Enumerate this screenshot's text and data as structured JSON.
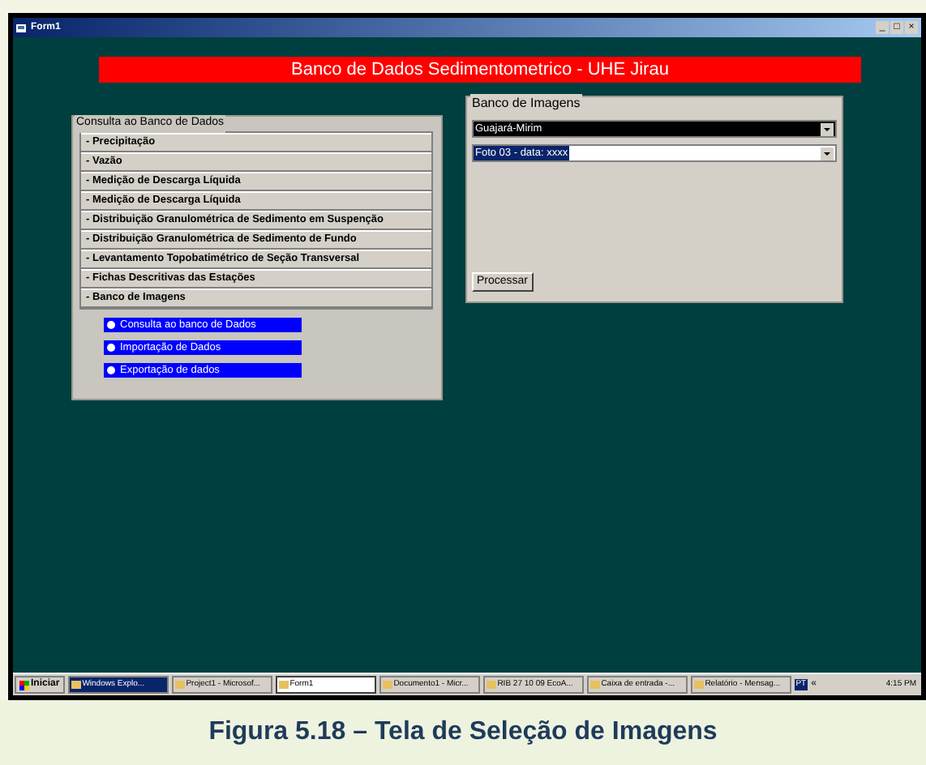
{
  "window": {
    "title": "Form1",
    "controls": [
      "_",
      "□",
      "×"
    ]
  },
  "banner": "Banco de Dados Sedimentometrico - UHE Jirau",
  "query_panel": {
    "legend": "Consulta ao Banco de Dados",
    "items": [
      "- Precipitação",
      "- Vazão",
      "- Medição de Descarga Líquida",
      "- Medição de Descarga Líquida",
      "- Distribuição Granulométrica de Sedimento em Suspenção",
      "- Distribuição Granulométrica de Sedimento de Fundo",
      "- Levantamento Topobatimétrico de Seção Transversal",
      "- Fichas Descritivas das Estações",
      "- Banco de Imagens"
    ],
    "options": [
      {
        "label": "Consulta ao banco de Dados",
        "selected": false
      },
      {
        "label": "Importação de  Dados",
        "selected": false
      },
      {
        "label": "Exportação de dados",
        "selected": false
      }
    ]
  },
  "image_panel": {
    "legend": "Banco de Imagens",
    "dropdowns": [
      {
        "value": "Guajará-Mirim",
        "kind": "inverted"
      },
      {
        "value": "Foto 03 - data: xxxx",
        "kind": "highlighted"
      }
    ],
    "button": "Processar"
  },
  "taskbar": {
    "start": "Iniciar",
    "items": [
      {
        "label": "Windows Explo...",
        "selected": false,
        "highlighted": true
      },
      {
        "label": "Project1 - Microsof...",
        "selected": false,
        "highlighted": false
      },
      {
        "label": "Form1",
        "selected": true,
        "highlighted": false
      },
      {
        "label": "Documento1 - Micr...",
        "selected": false,
        "highlighted": false
      },
      {
        "label": "RIB 27 10 09 EcoA...",
        "selected": false,
        "highlighted": false
      },
      {
        "label": "Caixa de entrada -...",
        "selected": false,
        "highlighted": false
      },
      {
        "label": "Relatório - Mensag...",
        "selected": false,
        "highlighted": false
      }
    ],
    "language": "PT",
    "chevron": "«",
    "clock": "4:15 PM"
  },
  "caption": "Figura 5.18 – Tela de Seleção de Imagens"
}
